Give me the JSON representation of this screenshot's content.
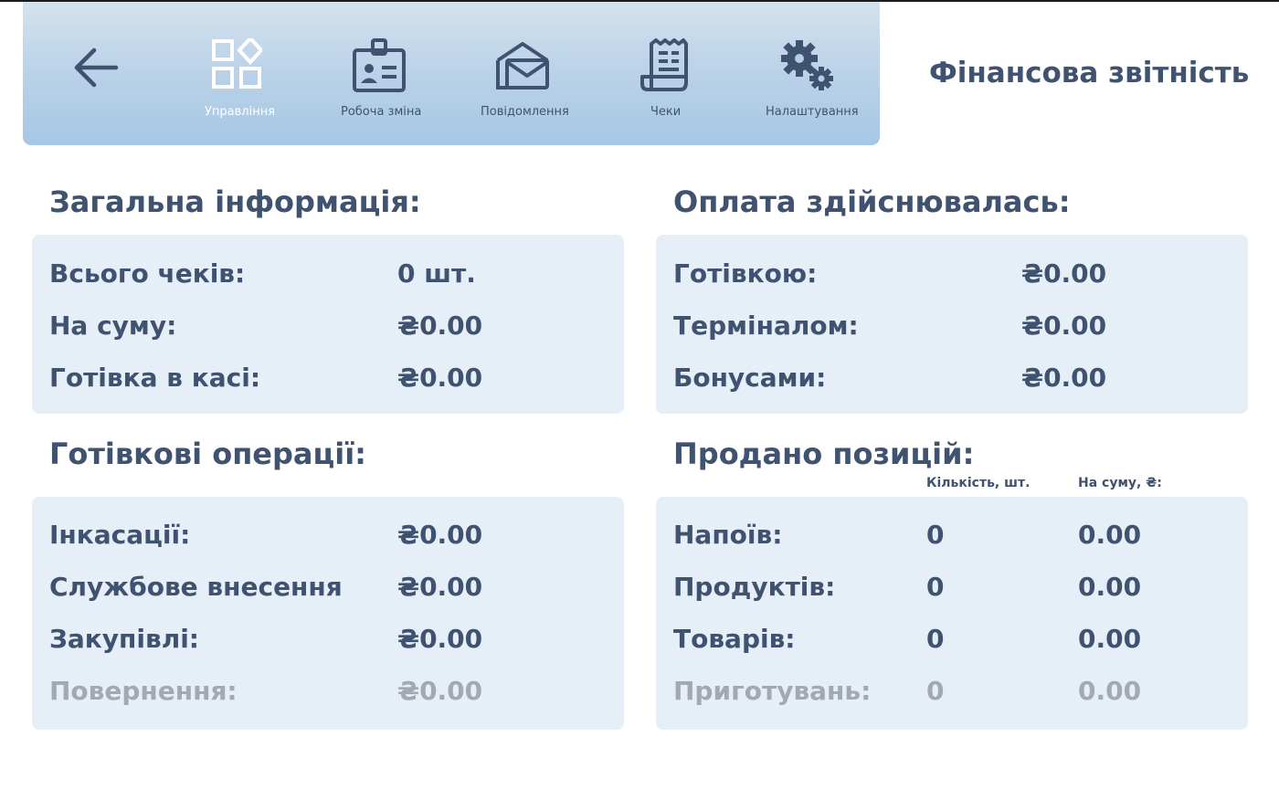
{
  "toolbar": {
    "items": [
      {
        "label": "Управління",
        "icon": "grid-squares-icon",
        "active": true
      },
      {
        "label": "Робоча зміна",
        "icon": "badge-id-icon",
        "active": false
      },
      {
        "label": "Повідомлення",
        "icon": "envelope-open-icon",
        "active": false
      },
      {
        "label": "Чеки",
        "icon": "receipt-icon",
        "active": false
      },
      {
        "label": "Налаштування",
        "icon": "gears-icon",
        "active": false
      }
    ]
  },
  "page_title": "Фінансова звітність",
  "general": {
    "title": "Загальна інформація:",
    "rows": [
      {
        "label": "Всього чеків:",
        "value": "0 шт."
      },
      {
        "label": "На суму:",
        "value": "₴0.00"
      },
      {
        "label": "Готівка в касі:",
        "value": "₴0.00"
      }
    ]
  },
  "payment": {
    "title": "Оплата здійснювалась:",
    "rows": [
      {
        "label": "Готівкою:",
        "value": "₴0.00"
      },
      {
        "label": "Терміналом:",
        "value": "₴0.00"
      },
      {
        "label": "Бонусами:",
        "value": "₴0.00"
      }
    ]
  },
  "cash_ops": {
    "title": "Готівкові операції:",
    "rows": [
      {
        "label": "Інкасації:",
        "value": "₴0.00"
      },
      {
        "label": "Службове внесення",
        "value": "₴0.00"
      },
      {
        "label": "Закупівлі:",
        "value": "₴0.00"
      },
      {
        "label": "Повернення:",
        "value": "₴0.00"
      }
    ]
  },
  "sold": {
    "title": "Продано позицій:",
    "col_qty": "Кількість, шт.",
    "col_sum": "На суму, ₴:",
    "rows": [
      {
        "label": "Напоїв:",
        "qty": "0",
        "sum": "0.00"
      },
      {
        "label": "Продуктів:",
        "qty": "0",
        "sum": "0.00"
      },
      {
        "label": "Товарів:",
        "qty": "0",
        "sum": "0.00"
      },
      {
        "label": "Приготувань:",
        "qty": "0",
        "sum": "0.00"
      }
    ]
  },
  "colors": {
    "text": "#3f5270",
    "panel": "#e6eef7",
    "muted": "#a3a9b0",
    "toolbar_top": "#d4e2ee",
    "toolbar_bottom": "#a6c7e5"
  }
}
